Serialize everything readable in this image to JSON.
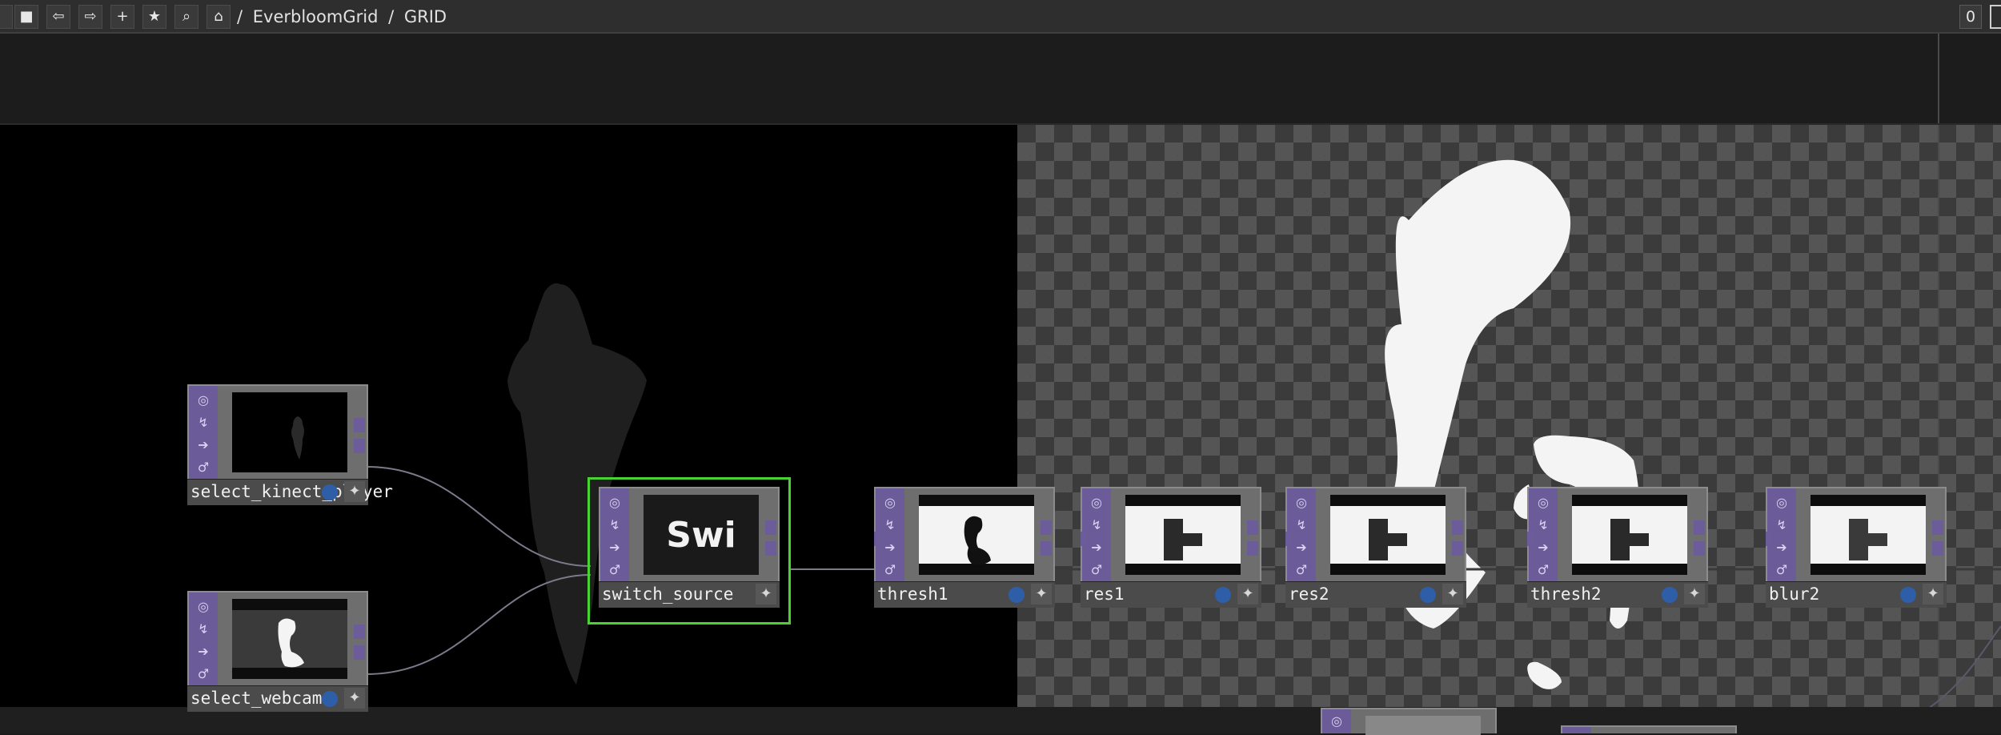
{
  "toolbar": {
    "buttons": [
      {
        "name": "stop-button",
        "glyph": "■"
      },
      {
        "name": "back-button",
        "glyph": "⇦"
      },
      {
        "name": "forward-button",
        "glyph": "⇨"
      },
      {
        "name": "add-button",
        "glyph": "+"
      },
      {
        "name": "bookmark-button",
        "glyph": "★"
      },
      {
        "name": "search-network-button",
        "glyph": "⌕"
      },
      {
        "name": "home-button",
        "glyph": "⌂"
      }
    ],
    "breadcrumb": [
      "/",
      "EverbloomGrid",
      "/",
      "GRID"
    ],
    "counter": "0"
  },
  "nodes": {
    "select_kinect_player": {
      "label": "select_kinect_player"
    },
    "select_webcam": {
      "label": "select_webcam"
    },
    "switch_source": {
      "label": "switch_source",
      "viewer_text": "Swi"
    },
    "thresh1": {
      "label": "thresh1"
    },
    "res1": {
      "label": "res1"
    },
    "res2": {
      "label": "res2"
    },
    "thresh2": {
      "label": "thresh2"
    },
    "blur2": {
      "label": "blur2"
    }
  },
  "flag_icons": [
    "bypass-icon",
    "lock-icon",
    "display-icon",
    "cook-icon"
  ],
  "colors": {
    "operator_strip": "#6b5b98",
    "selected_outline": "#49d331",
    "background_black": "#000000",
    "checker_dark": "#3b3b3b",
    "checker_light": "#555555"
  }
}
